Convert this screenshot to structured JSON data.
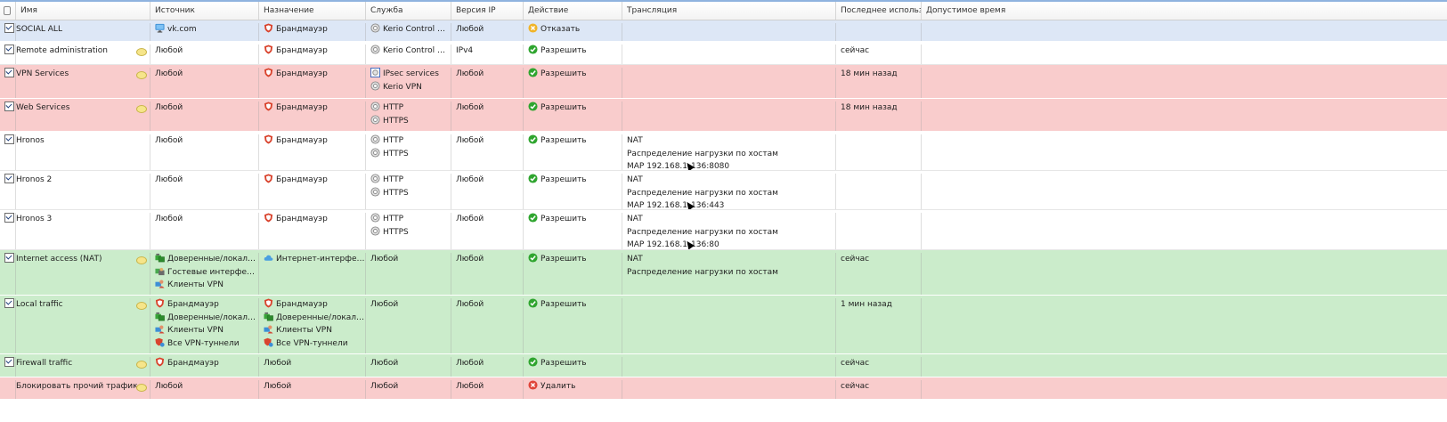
{
  "columns": [
    "Имя",
    "Источник",
    "Назначение",
    "Служба",
    "Версия IP",
    "Действие",
    "Трансляция",
    "Последнее использо...",
    "Допустимое время"
  ],
  "rows": [
    {
      "color": "blue",
      "checked": true,
      "comment": false,
      "name": "SOCIAL ALL",
      "source": [
        {
          "icon": "monitor-icon",
          "text": "vk.com"
        }
      ],
      "destination": [
        {
          "icon": "firewall-shield-icon",
          "text": "Брандмауэр"
        }
      ],
      "service": [
        {
          "icon": "service-gear-icon",
          "text": "Kerio Control W..."
        }
      ],
      "ipver": "Любой",
      "action": {
        "icon": "deny-icon",
        "text": "Отказать"
      },
      "translation": [],
      "lastused": "",
      "time": ""
    },
    {
      "color": "white",
      "checked": true,
      "comment": true,
      "name": "Remote administration",
      "source": [
        {
          "icon": "",
          "text": "Любой"
        }
      ],
      "destination": [
        {
          "icon": "firewall-shield-icon",
          "text": "Брандмауэр"
        }
      ],
      "service": [
        {
          "icon": "service-gear-icon",
          "text": "Kerio Control W..."
        }
      ],
      "ipver": "IPv4",
      "action": {
        "icon": "allow-icon",
        "text": "Разрешить"
      },
      "translation": [],
      "lastused": "сейчас",
      "time": ""
    },
    {
      "color": "red",
      "checked": true,
      "comment": true,
      "name": "VPN Services",
      "source": [
        {
          "icon": "",
          "text": "Любой"
        }
      ],
      "destination": [
        {
          "icon": "firewall-shield-icon",
          "text": "Брандмауэр"
        }
      ],
      "service": [
        {
          "icon": "service-group-icon",
          "text": "IPsec services"
        },
        {
          "icon": "service-gear-icon",
          "text": "Kerio VPN"
        }
      ],
      "ipver": "Любой",
      "action": {
        "icon": "allow-icon",
        "text": "Разрешить"
      },
      "translation": [],
      "lastused": "18 мин назад",
      "time": ""
    },
    {
      "color": "red",
      "checked": true,
      "comment": true,
      "name": "Web Services",
      "source": [
        {
          "icon": "",
          "text": "Любой"
        }
      ],
      "destination": [
        {
          "icon": "firewall-shield-icon",
          "text": "Брандмауэр"
        }
      ],
      "service": [
        {
          "icon": "service-gear-icon",
          "text": "HTTP"
        },
        {
          "icon": "service-gear-icon",
          "text": "HTTPS"
        }
      ],
      "ipver": "Любой",
      "action": {
        "icon": "allow-icon",
        "text": "Разрешить"
      },
      "translation": [],
      "lastused": "18 мин назад",
      "time": ""
    },
    {
      "color": "white",
      "checked": true,
      "comment": false,
      "name": "Hronos",
      "source": [
        {
          "icon": "",
          "text": "Любой"
        }
      ],
      "destination": [
        {
          "icon": "firewall-shield-icon",
          "text": "Брандмауэр"
        }
      ],
      "service": [
        {
          "icon": "service-gear-icon",
          "text": "HTTP"
        },
        {
          "icon": "service-gear-icon",
          "text": "HTTPS"
        }
      ],
      "ipver": "Любой",
      "action": {
        "icon": "allow-icon",
        "text": "Разрешить"
      },
      "translation": [
        "NAT",
        "Распределение нагрузки по хостам",
        {
          "pre": "MAP 192.168.1",
          "post": "136:8080"
        }
      ],
      "lastused": "",
      "time": ""
    },
    {
      "color": "white",
      "checked": true,
      "comment": false,
      "name": "Hronos 2",
      "source": [
        {
          "icon": "",
          "text": "Любой"
        }
      ],
      "destination": [
        {
          "icon": "firewall-shield-icon",
          "text": "Брандмауэр"
        }
      ],
      "service": [
        {
          "icon": "service-gear-icon",
          "text": "HTTP"
        },
        {
          "icon": "service-gear-icon",
          "text": "HTTPS"
        }
      ],
      "ipver": "Любой",
      "action": {
        "icon": "allow-icon",
        "text": "Разрешить"
      },
      "translation": [
        "NAT",
        "Распределение нагрузки по хостам",
        {
          "pre": "MAP 192.168.1",
          "post": "136:443"
        }
      ],
      "lastused": "",
      "time": ""
    },
    {
      "color": "white",
      "checked": true,
      "comment": false,
      "name": "Hronos 3",
      "source": [
        {
          "icon": "",
          "text": "Любой"
        }
      ],
      "destination": [
        {
          "icon": "firewall-shield-icon",
          "text": "Брандмауэр"
        }
      ],
      "service": [
        {
          "icon": "service-gear-icon",
          "text": "HTTP"
        },
        {
          "icon": "service-gear-icon",
          "text": "HTTPS"
        }
      ],
      "ipver": "Любой",
      "action": {
        "icon": "allow-icon",
        "text": "Разрешить"
      },
      "translation": [
        "NAT",
        "Распределение нагрузки по хостам",
        {
          "pre": "MAP 192.168.1",
          "post": "136:80"
        }
      ],
      "lastused": "",
      "time": ""
    },
    {
      "color": "green",
      "checked": true,
      "comment": true,
      "name": "Internet access (NAT)",
      "source": [
        {
          "icon": "trusted-interfaces-icon",
          "text": "Доверенные/локаль..."
        },
        {
          "icon": "guest-interfaces-icon",
          "text": "Гостевые интерфейсы"
        },
        {
          "icon": "vpn-clients-icon",
          "text": "Клиенты VPN"
        }
      ],
      "destination": [
        {
          "icon": "internet-cloud-icon",
          "text": "Интернет-интерфейсы"
        }
      ],
      "service": [
        {
          "icon": "",
          "text": "Любой"
        }
      ],
      "ipver": "Любой",
      "action": {
        "icon": "allow-icon",
        "text": "Разрешить"
      },
      "translation": [
        "NAT",
        "Распределение нагрузки по хостам"
      ],
      "lastused": "сейчас",
      "time": ""
    },
    {
      "color": "green",
      "checked": true,
      "comment": true,
      "name": "Local traffic",
      "source": [
        {
          "icon": "firewall-shield-icon",
          "text": "Брандмауэр"
        },
        {
          "icon": "trusted-interfaces-icon",
          "text": "Доверенные/локальн..."
        },
        {
          "icon": "vpn-clients-icon",
          "text": "Клиенты VPN"
        },
        {
          "icon": "vpn-tunnels-icon",
          "text": "Все VPN-туннели"
        }
      ],
      "destination": [
        {
          "icon": "firewall-shield-icon",
          "text": "Брандмауэр"
        },
        {
          "icon": "trusted-interfaces-icon",
          "text": "Доверенные/локальн..."
        },
        {
          "icon": "vpn-clients-icon",
          "text": "Клиенты VPN"
        },
        {
          "icon": "vpn-tunnels-icon",
          "text": "Все VPN-туннели"
        }
      ],
      "service": [
        {
          "icon": "",
          "text": "Любой"
        }
      ],
      "ipver": "Любой",
      "action": {
        "icon": "allow-icon",
        "text": "Разрешить"
      },
      "translation": [],
      "lastused": "1 мин назад",
      "time": ""
    },
    {
      "color": "green",
      "checked": true,
      "comment": true,
      "name": "Firewall traffic",
      "source": [
        {
          "icon": "firewall-shield-icon",
          "text": "Брандмауэр"
        }
      ],
      "destination": [
        {
          "icon": "",
          "text": "Любой"
        }
      ],
      "service": [
        {
          "icon": "",
          "text": "Любой"
        }
      ],
      "ipver": "Любой",
      "action": {
        "icon": "allow-icon",
        "text": "Разрешить"
      },
      "translation": [],
      "lastused": "сейчас",
      "time": ""
    },
    {
      "color": "red",
      "checked": false,
      "comment": true,
      "name": "Блокировать прочий трафик",
      "source": [
        {
          "icon": "",
          "text": "Любой"
        }
      ],
      "destination": [
        {
          "icon": "",
          "text": "Любой"
        }
      ],
      "service": [
        {
          "icon": "",
          "text": "Любой"
        }
      ],
      "ipver": "Любой",
      "action": {
        "icon": "drop-icon",
        "text": "Удалить"
      },
      "translation": [],
      "lastused": "сейчас",
      "time": ""
    }
  ],
  "colors": {
    "blue_row": "#dde7f6",
    "red_row": "#f9cccc",
    "green_row": "#cbeccb",
    "allow": "#2fa52f",
    "deny": "#f0b429",
    "drop": "#e0453a",
    "shield": "#d9442e"
  }
}
